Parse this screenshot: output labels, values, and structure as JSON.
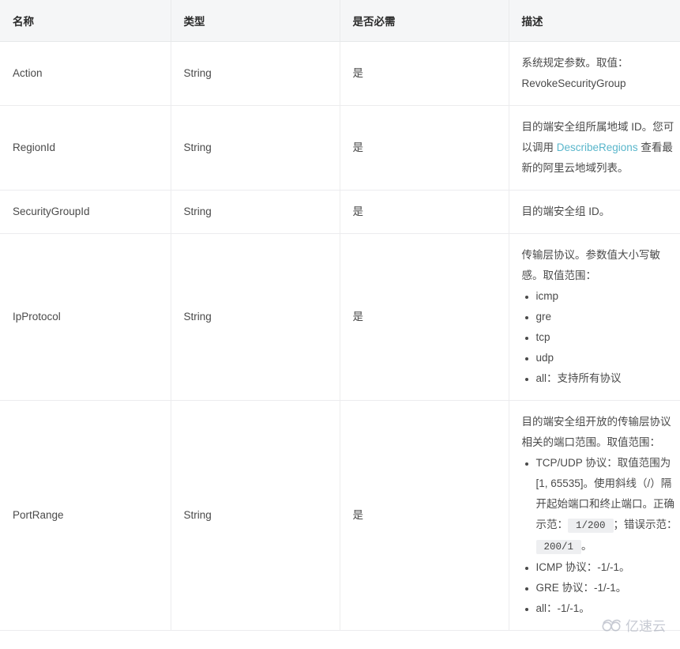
{
  "table": {
    "headers": [
      "名称",
      "类型",
      "是否必需",
      "描述"
    ],
    "rows": [
      {
        "name": "Action",
        "type": "String",
        "required": "是",
        "desc_lead": "系统规定参数。取值：RevokeSecurityGroup",
        "desc_items": []
      },
      {
        "name": "RegionId",
        "type": "String",
        "required": "是",
        "desc_before_link": "目的端安全组所属地域 ID。您可以调用 ",
        "link_text": "DescribeRegions",
        "desc_after_link": " 查看最新的阿里云地域列表。",
        "desc_items": []
      },
      {
        "name": "SecurityGroupId",
        "type": "String",
        "required": "是",
        "desc_lead": "目的端安全组 ID。",
        "desc_items": []
      },
      {
        "name": "IpProtocol",
        "type": "String",
        "required": "是",
        "desc_lead": "传输层协议。参数值大小写敏感。取值范围：",
        "desc_items": [
          "icmp",
          "gre",
          "tcp",
          "udp",
          "all：支持所有协议"
        ]
      },
      {
        "name": "PortRange",
        "type": "String",
        "required": "是",
        "desc_lead": "目的端安全组开放的传输层协议相关的端口范围。取值范围：",
        "desc_items": [
          "TCP/UDP 协议：取值范围为 [1, 65535]。使用斜线（/）隔开起始端口和终止端口。正确示范：",
          "ICMP 协议：-1/-1。",
          "GRE 协议：-1/-1。",
          "all：-1/-1。"
        ],
        "code_correct": "1/200",
        "mid_text": "；错误示范：",
        "code_wrong": "200/1",
        "tail_text": "。"
      }
    ]
  },
  "watermark": {
    "text": "亿速云"
  },
  "colors": {
    "link": "#59b6cb",
    "header_bg": "#f5f6f7",
    "border": "#ececee",
    "text": "#4a4a4a",
    "code_bg": "#eeeff1"
  }
}
